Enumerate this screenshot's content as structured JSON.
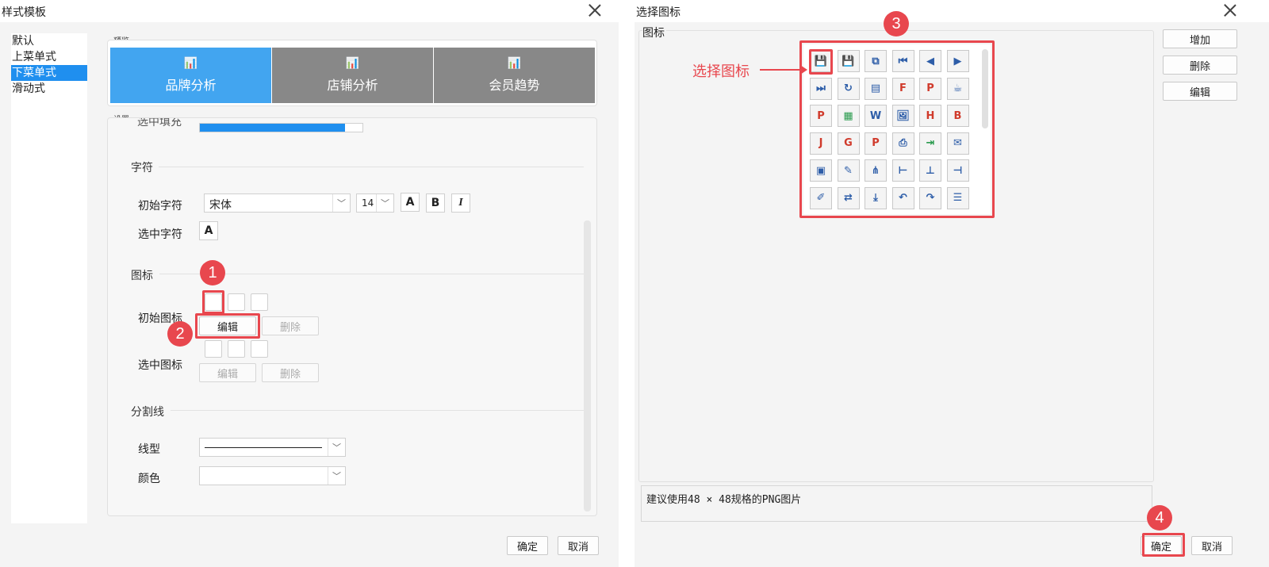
{
  "left_dialog": {
    "title": "样式模板",
    "nav_items": [
      "默认",
      "上菜单式",
      "下菜单式",
      "滑动式"
    ],
    "selected_nav_index": 2,
    "preview_label": "预览",
    "preview_tabs": [
      {
        "label": "品牌分析",
        "icon": "chart-icon",
        "color": "#42a5f0"
      },
      {
        "label": "店铺分析",
        "icon": "chart-icon",
        "color": "#888888"
      },
      {
        "label": "会员趋势",
        "icon": "chart-icon",
        "color": "#888888"
      }
    ],
    "settings_label": "设置",
    "clipped_row_label": "选中填充",
    "sections": {
      "character": "字符",
      "icon": "图标",
      "divider": "分割线"
    },
    "initial_char_label": "初始字符",
    "font_family": "宋体",
    "font_size": "14",
    "format_buttons": [
      "A",
      "B",
      "I"
    ],
    "selected_char_label": "选中字符",
    "selected_char_button": "A",
    "initial_icon_label": "初始图标",
    "selected_icon_label": "选中图标",
    "edit_label": "编辑",
    "delete_label": "删除",
    "line_type_label": "线型",
    "color_label": "颜色",
    "ok_label": "确定",
    "cancel_label": "取消"
  },
  "right_dialog": {
    "title": "选择图标",
    "panel_label": "图标",
    "side_buttons": [
      "增加",
      "删除",
      "编辑"
    ],
    "hint": "建议使用48 × 48规格的PNG图片",
    "ok_label": "确定",
    "cancel_label": "取消",
    "annotation": "选择图标",
    "icons": [
      [
        "save-icon",
        "save-as-icon",
        "copy-icon",
        "first-page-icon",
        "prev-page-icon",
        "next-page-icon"
      ],
      [
        "last-page-icon",
        "refresh-icon",
        "book-icon",
        "flash-icon",
        "pdf-icon",
        "java-icon"
      ],
      [
        "pdf-red-icon",
        "excel-icon",
        "word-icon",
        "image-icon",
        "html-icon",
        "bmp-icon"
      ],
      [
        "jpg-icon",
        "gif-icon",
        "png-icon",
        "print-icon",
        "export-icon",
        "mail-icon"
      ],
      [
        "layout-icon",
        "tooltip-icon",
        "tree-down-icon",
        "tree-right-icon",
        "tree-up-icon",
        "tree-left-icon"
      ],
      [
        "pencil-icon",
        "submit-icon",
        "download-icon",
        "undo-icon",
        "redo-icon",
        "list-icon"
      ]
    ],
    "icon_glyphs": [
      [
        "💾",
        "💾",
        "⧉",
        "⏮",
        "◀",
        "▶"
      ],
      [
        "⏭",
        "↻",
        "▤",
        "F",
        "P",
        "☕"
      ],
      [
        "P",
        "▦",
        "W",
        "🖼",
        "H",
        "B"
      ],
      [
        "J",
        "G",
        "P",
        "⎙",
        "⇥",
        "✉"
      ],
      [
        "▣",
        "✎",
        "⋔",
        "⊢",
        "⊥",
        "⊣"
      ],
      [
        "✐",
        "⇄",
        "⤓",
        "↶",
        "↷",
        "☰"
      ]
    ]
  },
  "markers": [
    "1",
    "2",
    "3",
    "4"
  ],
  "colors": {
    "annotation_red": "#e8474e",
    "accent_blue": "#1f8fef"
  }
}
